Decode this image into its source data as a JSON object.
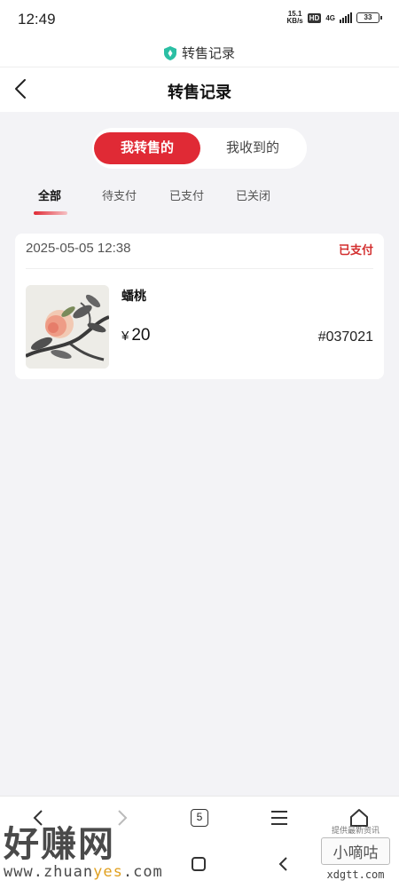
{
  "status_bar": {
    "time": "12:49",
    "speed_value": "15.1",
    "speed_unit": "KB/s",
    "hd": "HD",
    "network": "4G",
    "battery": "33"
  },
  "browser": {
    "url_title": "转售记录",
    "tab_count": "5"
  },
  "header": {
    "title": "转售记录"
  },
  "segment": {
    "active_label": "我转售的",
    "inactive_label": "我收到的"
  },
  "filter_tabs": [
    {
      "label": "全部",
      "active": true
    },
    {
      "label": "待支付",
      "active": false
    },
    {
      "label": "已支付",
      "active": false
    },
    {
      "label": "已关闭",
      "active": false
    }
  ],
  "order": {
    "date": "2025-05-05 12:38",
    "status": "已支付",
    "product_name": "蟠桃",
    "currency": "¥",
    "price": "20",
    "number": "#037021",
    "status_color": "#d32f2f"
  },
  "watermarks": {
    "left_big": "好赚网",
    "left_small_a": "www.zhuan",
    "left_small_b": "yes",
    "left_small_c": ".com",
    "right_top": "提供最新资讯",
    "right_mid": "小嘀咕",
    "right_bottom": "xdgtt.com"
  },
  "colors": {
    "accent": "#e02a35",
    "background": "#f3f3f6"
  }
}
